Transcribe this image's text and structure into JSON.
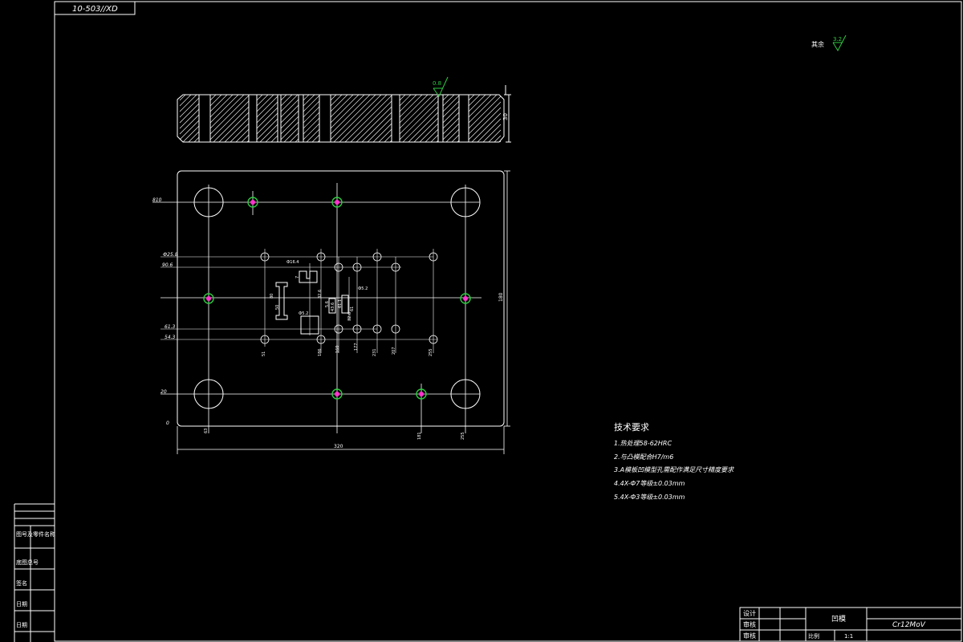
{
  "drawing_code": "10-503//XD",
  "surface_note": {
    "label": "其余",
    "roughness": "3.2"
  },
  "section_roughness": "0.8",
  "section_dims": {
    "height": "30"
  },
  "plan_dims": {
    "overall_width": "320",
    "overall_height": "180",
    "left_labels": [
      "810",
      "Ф25.8",
      "90.6",
      "61.3",
      "54.3",
      "20",
      "0"
    ],
    "bottom_labels": [
      "63",
      "51",
      "186",
      "160",
      "177",
      "231",
      "207",
      "255",
      "181",
      "255"
    ],
    "inner_labels": [
      "Ф16.4",
      "7",
      "80",
      "32.6",
      "Ф5.2",
      "43.6",
      "61",
      "61.1",
      "50",
      "32.6",
      "Ф5.2",
      "5.6"
    ]
  },
  "tech_req": {
    "title": "技术要求",
    "items": [
      "1.热处理58-62HRC",
      "2.与凸模配合H7/m6",
      "3.A模板凹模型孔需配作满足尺寸精度要求",
      "4.4X-Ф7等级±0.03mm",
      "5.4X-Ф3等级±0.03mm"
    ]
  },
  "title_block": {
    "rows": [
      "设计",
      "审核",
      "审核"
    ],
    "part_name": "凹模",
    "material": "Cr12MoV",
    "scale_label": "比例",
    "scale_value": "1:1"
  },
  "side_panel": {
    "labels": [
      "图号及零件名称",
      "底图总号",
      "签名",
      "日期",
      "日期"
    ]
  },
  "colors": {
    "line": "#ffffff",
    "green": "#2ecc40",
    "magenta": "#ff33cc"
  }
}
